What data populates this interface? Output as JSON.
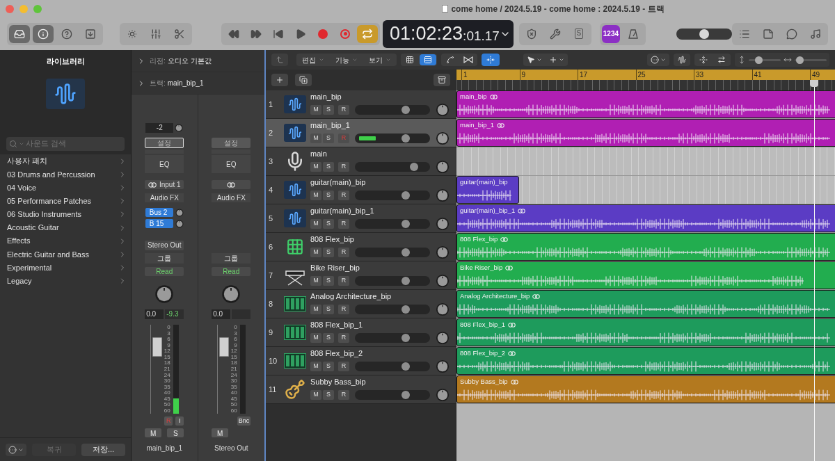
{
  "window": {
    "title": "come home / 2024.5.19 - come home : 2024.5.19 - 트랙"
  },
  "toolbar": {
    "view_buttons": [
      {
        "selected": true
      },
      {
        "selected": true
      },
      {
        "selected": false
      },
      {
        "selected": false
      }
    ],
    "cycle": {
      "on": true
    },
    "lcd": {
      "time": "01:02:23",
      "frames": ":01.17"
    },
    "solo_key": "S",
    "count_in": {
      "label": "1234",
      "on": true
    },
    "master_volume": {
      "level": 0.5
    }
  },
  "library": {
    "title": "라이브러리",
    "search": {
      "placeholder": "사운드 검색"
    },
    "items": [
      "사용자 패치",
      "03 Drums and Percussion",
      "04 Voice",
      "05 Performance Patches",
      "06 Studio Instruments",
      "Acoustic Guitar",
      "Effects",
      "Electric Guitar and Bass",
      "Experimental",
      "Legacy"
    ],
    "footer": [
      {
        "label": "복귀",
        "disabled": true
      },
      {
        "label": "저장...",
        "disabled": false
      }
    ]
  },
  "inspector": {
    "sections": [
      {
        "label": "리전:",
        "value": "오디오 기본값"
      },
      {
        "label": "트랙:",
        "value": "main_bip_1"
      }
    ]
  },
  "mixer": {
    "strips": [
      {
        "gain": "-2",
        "setting": {
          "label": "설정",
          "selected": true
        },
        "eq": "EQ",
        "input": "Input 1",
        "audio_fx": "Audio FX",
        "sends": [
          "Bus 2",
          "B 15"
        ],
        "output": "Stereo Out",
        "group": "그룹",
        "automation": "Read",
        "volume": "0.0",
        "peak": "-9.3",
        "scale": [
          "0",
          "3",
          "6",
          "9",
          "12",
          "15",
          "18",
          "21",
          "24",
          "30",
          "35",
          "40",
          "45",
          "50",
          "60"
        ],
        "fader": {
          "level": 0.75
        },
        "meter": {
          "level": 0.17
        },
        "buttons": [
          {
            "label": "R",
            "on": true
          },
          {
            "label": "I",
            "on": false
          }
        ],
        "mute_solo": [
          {
            "label": "M",
            "on": false
          },
          {
            "label": "S",
            "on": false
          }
        ],
        "name": "main_bip_1"
      },
      {
        "setting": {
          "label": "설정",
          "selected": false
        },
        "eq": "EQ",
        "audio_fx": "Audio FX",
        "group": "그룹",
        "automation": "Read",
        "volume": "0.0",
        "scale": [
          "0",
          "3",
          "6",
          "9",
          "12",
          "15",
          "18",
          "21",
          "24",
          "30",
          "35",
          "40",
          "45",
          "50",
          "60"
        ],
        "fader": {
          "level": 0.75
        },
        "buttons": [
          {
            "label": "Bnc",
            "on": false
          }
        ],
        "mute_solo": [
          {
            "label": "M",
            "on": false
          }
        ],
        "name": "Stereo Out"
      }
    ]
  },
  "tracks_toolbar": {
    "menus": [
      "편집",
      "기능",
      "보기"
    ],
    "view_toggles": [
      {
        "selected": false
      },
      {
        "selected": true
      }
    ],
    "snap": {
      "on": true
    },
    "sliders": [
      {
        "level": 0.3
      },
      {
        "level": 0.15
      }
    ]
  },
  "ruler": {
    "bars": [
      "1",
      "9",
      "17",
      "25",
      "33",
      "41",
      "49"
    ]
  },
  "playhead": {
    "level": 0.867
  },
  "tracks": [
    {
      "number": "1",
      "name": "main_bip",
      "kind": "audio",
      "selected": false,
      "buttons": [
        {
          "label": "M",
          "on": false
        },
        {
          "label": "S",
          "on": false
        },
        {
          "label": "R",
          "on": false
        }
      ],
      "volume": {
        "level": 0.68
      },
      "region": {
        "label": "main_bip",
        "color": "#b01fb3",
        "level": 1,
        "stereo": true
      }
    },
    {
      "number": "2",
      "name": "main_bip_1",
      "kind": "audio",
      "selected": true,
      "buttons": [
        {
          "label": "M",
          "on": false
        },
        {
          "label": "S",
          "on": false
        },
        {
          "label": "R",
          "on": true
        }
      ],
      "volume": {
        "level": 0.68
      },
      "meter": {
        "level": 0.22
      },
      "region": {
        "label": "main_bip_1",
        "color": "#b01fb3",
        "level": 1,
        "stereo": true
      }
    },
    {
      "number": "3",
      "name": "main",
      "kind": "mic",
      "selected": false,
      "buttons": [
        {
          "label": "M",
          "on": false
        },
        {
          "label": "S",
          "on": false
        },
        {
          "label": "R",
          "on": false
        }
      ],
      "volume": {
        "level": 0.79
      }
    },
    {
      "number": "4",
      "name": "guitar(main)_bip",
      "kind": "audio",
      "selected": false,
      "buttons": [
        {
          "label": "M",
          "on": false
        },
        {
          "label": "S",
          "on": false
        },
        {
          "label": "R",
          "on": false
        }
      ],
      "volume": {
        "level": 0.68
      },
      "region": {
        "label": "guitar(main)_bip",
        "color": "#5b3cc4",
        "level": 0.152,
        "stereo": false
      }
    },
    {
      "number": "5",
      "name": "guitar(main)_bip_1",
      "kind": "audio",
      "selected": false,
      "buttons": [
        {
          "label": "M",
          "on": false
        },
        {
          "label": "S",
          "on": false
        },
        {
          "label": "R",
          "on": false
        }
      ],
      "volume": {
        "level": 0.68
      },
      "region": {
        "label": "guitar(main)_bip_1",
        "color": "#5b3cc4",
        "level": 1,
        "stereo": true
      }
    },
    {
      "number": "6",
      "name": "808 Flex_bip",
      "kind": "drum",
      "selected": false,
      "buttons": [
        {
          "label": "M",
          "on": false
        },
        {
          "label": "S",
          "on": false
        },
        {
          "label": "R",
          "on": false
        }
      ],
      "volume": {
        "level": 0.68
      },
      "region": {
        "label": "808 Flex_bip",
        "color": "#22ad4f",
        "level": 1,
        "stereo": true
      }
    },
    {
      "number": "7",
      "name": "Bike Riser_bip",
      "kind": "keyboard",
      "selected": false,
      "buttons": [
        {
          "label": "M",
          "on": false
        },
        {
          "label": "S",
          "on": false
        },
        {
          "label": "R",
          "on": false
        }
      ],
      "volume": {
        "level": 0.68
      },
      "region": {
        "label": "Bike Riser_bip",
        "color": "#22ad4f",
        "level": 0.93,
        "stereo": true
      }
    },
    {
      "number": "8",
      "name": "Analog Architecture_bip",
      "kind": "synth",
      "selected": false,
      "buttons": [
        {
          "label": "M",
          "on": false
        },
        {
          "label": "S",
          "on": false
        },
        {
          "label": "R",
          "on": false
        }
      ],
      "volume": {
        "level": 0.68
      },
      "region": {
        "label": "Analog Architecture_bip",
        "color": "#1e9b5c",
        "level": 1,
        "stereo": true
      }
    },
    {
      "number": "9",
      "name": "808 Flex_bip_1",
      "kind": "synth",
      "selected": false,
      "buttons": [
        {
          "label": "M",
          "on": false
        },
        {
          "label": "S",
          "on": false
        },
        {
          "label": "R",
          "on": false
        }
      ],
      "volume": {
        "level": 0.68
      },
      "region": {
        "label": "808 Flex_bip_1",
        "color": "#1e9b5c",
        "level": 1,
        "stereo": true
      }
    },
    {
      "number": "10",
      "name": "808 Flex_bip_2",
      "kind": "synth",
      "selected": false,
      "buttons": [
        {
          "label": "M",
          "on": false
        },
        {
          "label": "S",
          "on": false
        },
        {
          "label": "R",
          "on": false
        }
      ],
      "volume": {
        "level": 0.68
      },
      "region": {
        "label": "808 Flex_bip_2",
        "color": "#1e9b5c",
        "level": 1,
        "stereo": true
      }
    },
    {
      "number": "11",
      "name": "Subby Bass_bip",
      "kind": "bass",
      "selected": false,
      "buttons": [
        {
          "label": "M",
          "on": false
        },
        {
          "label": "S",
          "on": false
        },
        {
          "label": "R",
          "on": false
        }
      ],
      "volume": {
        "level": 0.68
      },
      "region": {
        "label": "Subby Bass_bip",
        "color": "#b3791f",
        "level": 1,
        "stereo": true
      }
    }
  ]
}
